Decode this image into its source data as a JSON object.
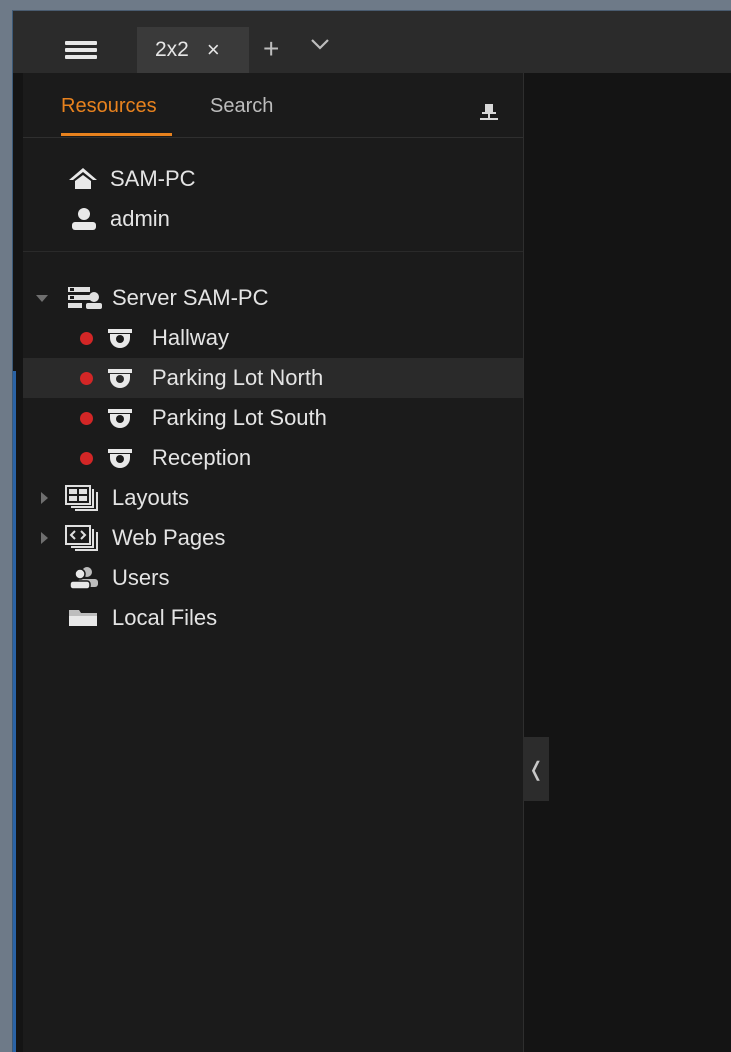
{
  "toolbar": {
    "tab_label": "2x2",
    "tab_close": "×",
    "add_tab": "+"
  },
  "panel": {
    "tabs": [
      {
        "label": "Resources",
        "active": true
      },
      {
        "label": "Search",
        "active": false
      }
    ]
  },
  "user_section": {
    "server_name": "SAM-PC",
    "user_name": "admin"
  },
  "tree": {
    "server": "Server SAM-PC",
    "cameras": [
      {
        "label": "Hallway",
        "status": "offline"
      },
      {
        "label": "Parking Lot North",
        "status": "offline",
        "selected": true
      },
      {
        "label": "Parking Lot South",
        "status": "offline"
      },
      {
        "label": "Reception",
        "status": "offline"
      }
    ],
    "layouts": "Layouts",
    "web_pages": "Web Pages",
    "users": "Users",
    "local_files": "Local Files"
  },
  "colors": {
    "accent": "#e8821e",
    "status_offline": "#d32626",
    "background": "#1b1b1b"
  },
  "collapse_glyph": "❬"
}
